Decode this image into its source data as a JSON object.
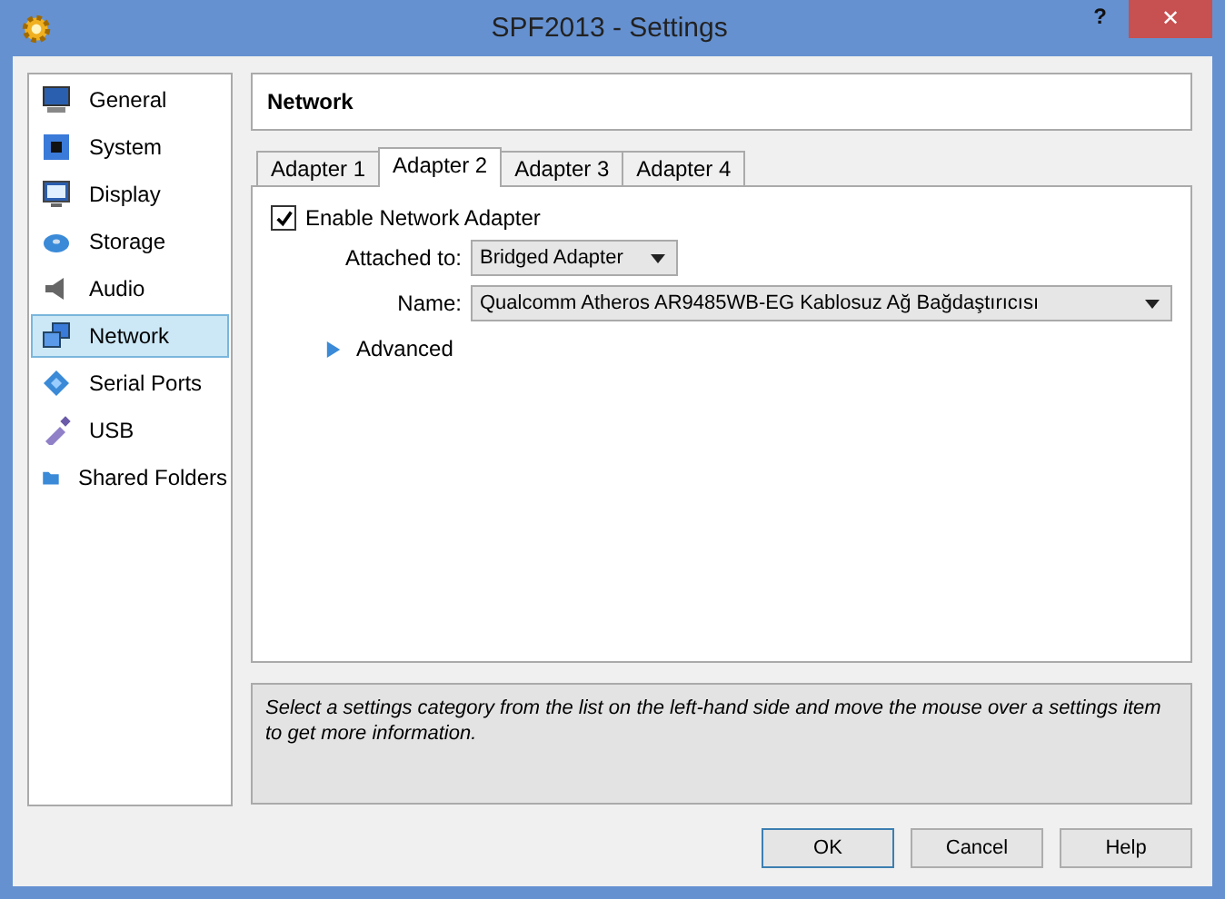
{
  "window": {
    "title": "SPF2013 - Settings",
    "help": "?",
    "close": "✕"
  },
  "sidebar": {
    "items": [
      {
        "label": "General",
        "kind": "monitor",
        "selected": false
      },
      {
        "label": "System",
        "kind": "chip",
        "selected": false
      },
      {
        "label": "Display",
        "kind": "display",
        "selected": false
      },
      {
        "label": "Storage",
        "kind": "disk",
        "selected": false
      },
      {
        "label": "Audio",
        "kind": "speaker",
        "selected": false
      },
      {
        "label": "Network",
        "kind": "network",
        "selected": true
      },
      {
        "label": "Serial Ports",
        "kind": "serial",
        "selected": false
      },
      {
        "label": "USB",
        "kind": "usb",
        "selected": false
      },
      {
        "label": "Shared Folders",
        "kind": "folder",
        "selected": false
      }
    ]
  },
  "section_title": "Network",
  "tabs": [
    {
      "label": "Adapter 1",
      "selected": false
    },
    {
      "label": "Adapter 2",
      "selected": true
    },
    {
      "label": "Adapter 3",
      "selected": false
    },
    {
      "label": "Adapter 4",
      "selected": false
    }
  ],
  "enable": {
    "label": "Enable Network Adapter",
    "checked": true
  },
  "attached": {
    "label": "Attached to:",
    "value": "Bridged Adapter"
  },
  "name": {
    "label": "Name:",
    "value": "Qualcomm Atheros AR9485WB-EG Kablosuz Ağ Bağdaştırıcısı"
  },
  "advanced": {
    "label": "Advanced",
    "expanded": false
  },
  "info": "Select a settings category from the list on the left-hand side and move the mouse over a settings item to get more information.",
  "buttons": [
    {
      "label": "OK",
      "default": true
    },
    {
      "label": "Cancel",
      "default": false
    },
    {
      "label": "Help",
      "default": false
    }
  ]
}
